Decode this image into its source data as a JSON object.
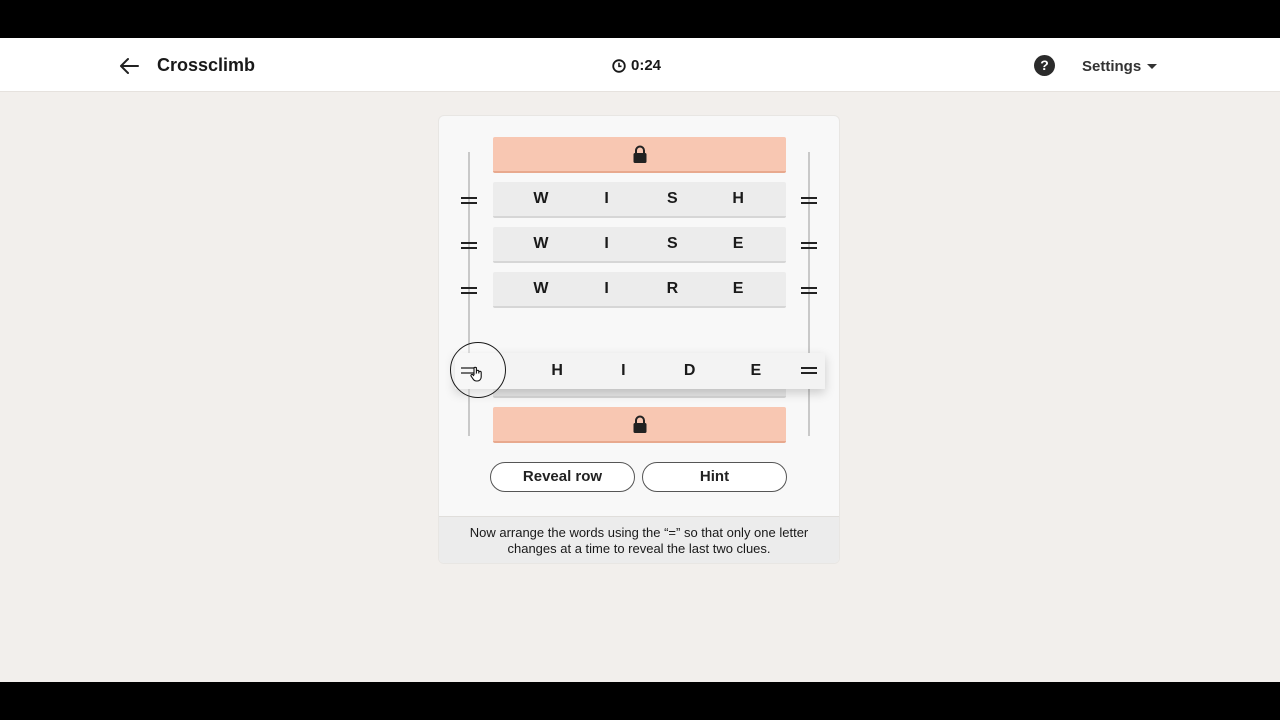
{
  "header": {
    "title": "Crossclimb",
    "timer": "0:24",
    "help_label": "?",
    "settings_label": "Settings"
  },
  "board": {
    "rows": [
      {
        "locked": true
      },
      {
        "letters": [
          "W",
          "I",
          "S",
          "H"
        ]
      },
      {
        "letters": [
          "W",
          "I",
          "S",
          "E"
        ]
      },
      {
        "letters": [
          "W",
          "I",
          "R",
          "E"
        ]
      },
      {
        "letters": []
      },
      {
        "locked": true
      }
    ],
    "dragged_row": {
      "letters": [
        "H",
        "I",
        "D",
        "E"
      ]
    }
  },
  "buttons": {
    "reveal_row": "Reveal row",
    "hint": "Hint"
  },
  "instructions": "Now arrange the words using the “=” so that only one letter changes at a time to reveal the last two clues.",
  "colors": {
    "locked_row": "#f8c7b2",
    "background": "#f2efec"
  }
}
